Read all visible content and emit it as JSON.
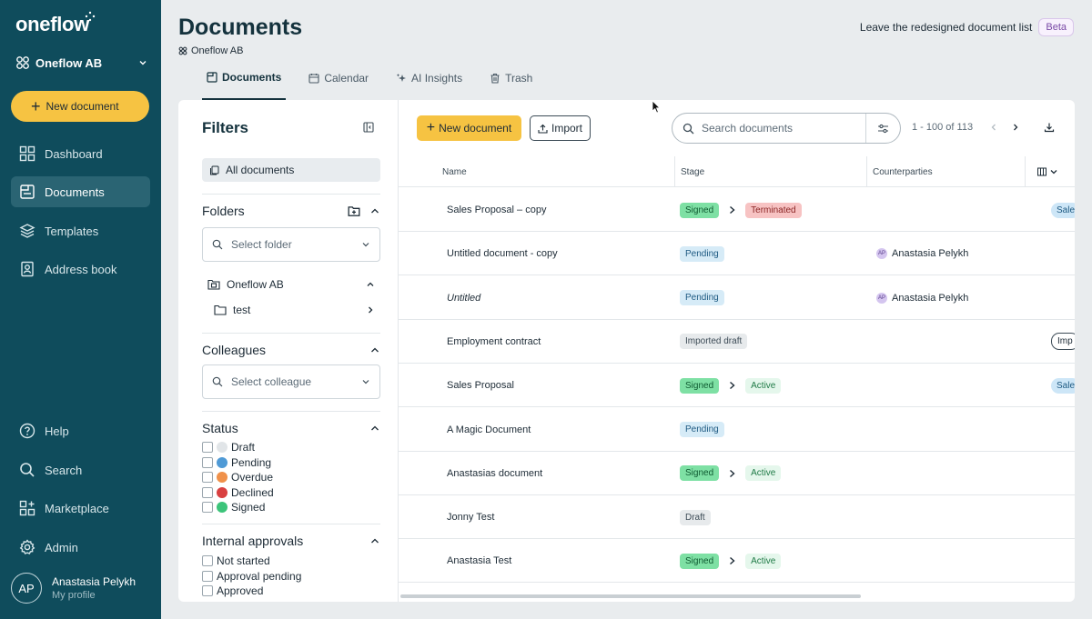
{
  "sidebar": {
    "logo": "oneflow",
    "workspace": "Oneflow AB",
    "new_document": "New document",
    "nav": [
      {
        "label": "Dashboard",
        "icon": "dashboard-icon"
      },
      {
        "label": "Documents",
        "icon": "documents-icon",
        "active": true
      },
      {
        "label": "Templates",
        "icon": "templates-icon"
      },
      {
        "label": "Address book",
        "icon": "address-book-icon"
      }
    ],
    "bottom_nav": [
      {
        "label": "Help",
        "icon": "help-icon"
      },
      {
        "label": "Search",
        "icon": "search-icon"
      },
      {
        "label": "Marketplace",
        "icon": "marketplace-icon"
      },
      {
        "label": "Admin",
        "icon": "gear-icon"
      }
    ],
    "profile": {
      "initials": "AP",
      "name": "Anastasia Pelykh",
      "sub": "My profile"
    }
  },
  "header": {
    "title": "Documents",
    "subtitle": "Oneflow AB",
    "redesign_label": "Leave the redesigned document list",
    "beta": "Beta",
    "tabs": [
      {
        "label": "Documents",
        "active": true
      },
      {
        "label": "Calendar"
      },
      {
        "label": "AI Insights"
      },
      {
        "label": "Trash"
      }
    ]
  },
  "filters": {
    "title": "Filters",
    "all_documents": "All documents",
    "folders": {
      "title": "Folders",
      "placeholder": "Select folder",
      "tree": [
        {
          "label": "Oneflow AB"
        },
        {
          "label": "test"
        }
      ]
    },
    "colleagues": {
      "title": "Colleagues",
      "placeholder": "Select colleague"
    },
    "status": {
      "title": "Status",
      "items": [
        {
          "label": "Draft",
          "color": "#e1e5e8"
        },
        {
          "label": "Pending",
          "color": "#4f9ad6"
        },
        {
          "label": "Overdue",
          "color": "#f0914a"
        },
        {
          "label": "Declined",
          "color": "#d94040"
        },
        {
          "label": "Signed",
          "color": "#3cc47a"
        }
      ]
    },
    "internal_approvals": {
      "title": "Internal approvals",
      "items": [
        {
          "label": "Not started"
        },
        {
          "label": "Approval pending"
        },
        {
          "label": "Approved"
        }
      ]
    }
  },
  "toolbar": {
    "new_document": "New document",
    "import": "Import",
    "search_placeholder": "Search documents",
    "pagination": "1 - 100 of 113"
  },
  "table": {
    "headers": {
      "name": "Name",
      "stage": "Stage",
      "counterparties": "Counterparties"
    },
    "rows": [
      {
        "name": "Sales Proposal – copy",
        "stage": "Signed",
        "stage_class": "signed",
        "state": "Terminated",
        "state_class": "terminated",
        "counterparty": "",
        "tag": "Sale",
        "tag_class": "sales"
      },
      {
        "name": "Untitled document - copy",
        "stage": "Pending",
        "stage_class": "pending",
        "state": "",
        "counterparty": "Anastasia Pelykh",
        "tag": ""
      },
      {
        "name": "Untitled",
        "italic": true,
        "stage": "Pending",
        "stage_class": "pending",
        "state": "",
        "counterparty": "Anastasia Pelykh",
        "tag": ""
      },
      {
        "name": "Employment contract",
        "stage": "Imported draft",
        "stage_class": "imported",
        "state": "",
        "counterparty": "",
        "tag": "Imp",
        "tag_class": "imp"
      },
      {
        "name": "Sales Proposal",
        "stage": "Signed",
        "stage_class": "signed",
        "state": "Active",
        "state_class": "active",
        "counterparty": "",
        "tag": "Sale",
        "tag_class": "sales"
      },
      {
        "name": "A Magic Document",
        "stage": "Pending",
        "stage_class": "pending",
        "state": "",
        "counterparty": "",
        "tag": ""
      },
      {
        "name": "Anastasias document",
        "stage": "Signed",
        "stage_class": "signed",
        "state": "Active",
        "state_class": "active",
        "counterparty": "",
        "tag": ""
      },
      {
        "name": "Jonny Test",
        "stage": "Draft",
        "stage_class": "draft",
        "state": "",
        "counterparty": "",
        "tag": ""
      },
      {
        "name": "Anastasia Test",
        "stage": "Signed",
        "stage_class": "signed",
        "state": "Active",
        "state_class": "active",
        "counterparty": "",
        "tag": ""
      }
    ]
  }
}
